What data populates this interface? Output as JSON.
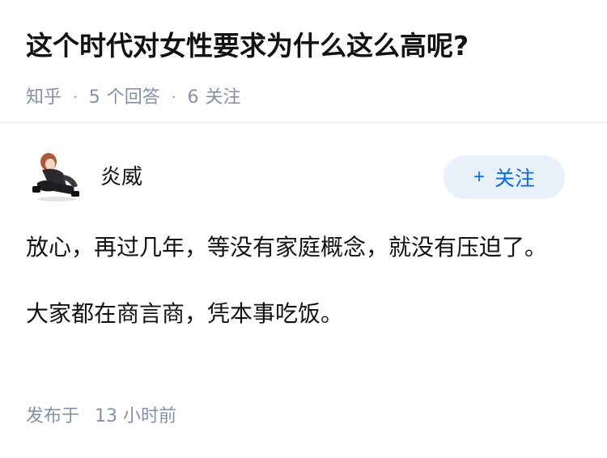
{
  "question": {
    "title": "这个时代对女性要求为什么这么高呢?",
    "source": "知乎",
    "answer_count": "5",
    "answer_label": "个回答",
    "follower_count": "6",
    "follower_label": "关注"
  },
  "author": {
    "name": "炎威",
    "avatar_icon": "avatar-illustration-icon"
  },
  "follow_button": {
    "plus": "+",
    "label": "关注",
    "color": "#056de8",
    "background": "#e8f0fa"
  },
  "answer": {
    "paragraphs": [
      "放心，再过几年，等没有家庭概念，就没有压迫了。",
      "大家都在商言商，凭本事吃饭。"
    ],
    "time_label": "发布于",
    "time_value": "13 小时前"
  }
}
